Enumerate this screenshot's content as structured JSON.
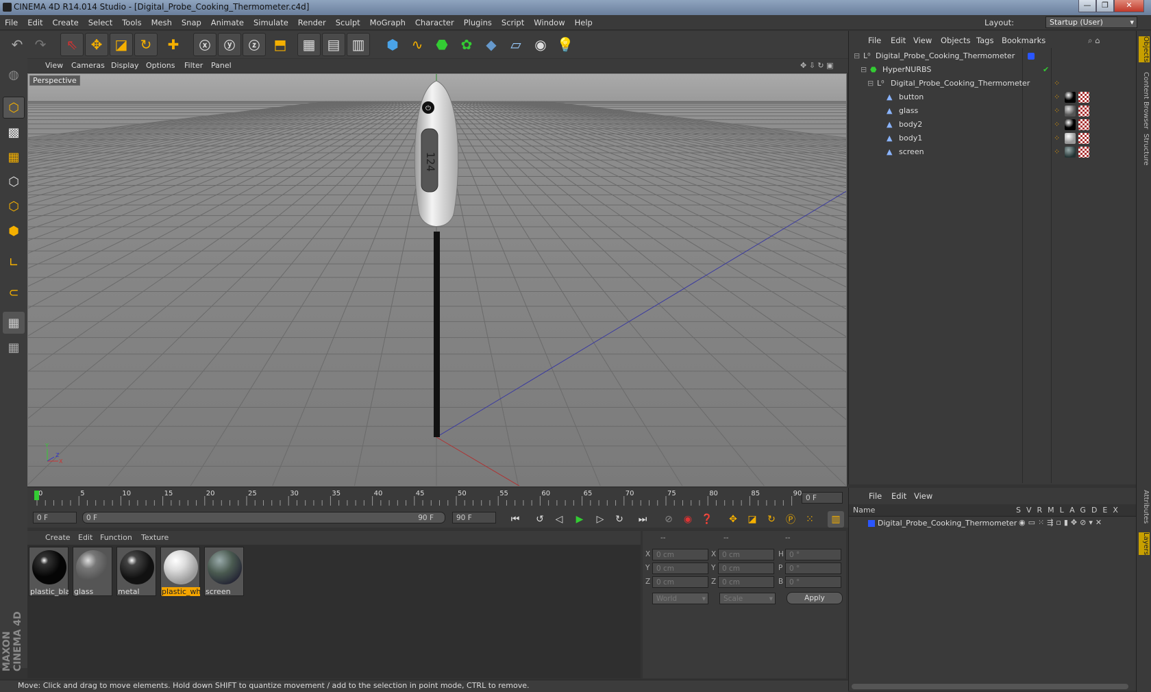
{
  "window": {
    "title": "CINEMA 4D R14.014 Studio - [Digital_Probe_Cooking_Thermometer.c4d]",
    "min": "—",
    "max": "❐",
    "close": "✕"
  },
  "menu": [
    "File",
    "Edit",
    "Create",
    "Select",
    "Tools",
    "Mesh",
    "Snap",
    "Animate",
    "Simulate",
    "Render",
    "Sculpt",
    "MoGraph",
    "Character",
    "Plugins",
    "Script",
    "Window",
    "Help"
  ],
  "layout": {
    "label": "Layout:",
    "value": "Startup (User)"
  },
  "toolbar_icons": [
    "undo-icon",
    "redo-icon",
    "live-selection-icon",
    "move-icon",
    "scale-icon",
    "rotate-icon",
    "add-icon",
    "x-axis-icon",
    "y-axis-icon",
    "z-axis-icon",
    "coordinate-system-icon",
    "render-view-icon",
    "render-picture-viewer-icon",
    "render-settings-icon",
    "cube-icon",
    "spline-pen-icon",
    "nurbs-icon",
    "array-icon",
    "deformer-icon",
    "floor-icon",
    "camera-icon",
    "light-icon"
  ],
  "viewport": {
    "menu": [
      "View",
      "Cameras",
      "Display",
      "Options",
      "Filter",
      "Panel"
    ],
    "label": "Perspective"
  },
  "timeline": {
    "ticks": [
      "0",
      "5",
      "10",
      "15",
      "20",
      "25",
      "30",
      "35",
      "40",
      "45",
      "50",
      "55",
      "60",
      "65",
      "70",
      "75",
      "80",
      "85",
      "90"
    ],
    "current": "0 F",
    "start": "0 F",
    "range_start": "0 F",
    "range_end": "90 F",
    "end": "90 F"
  },
  "materials": {
    "menu": [
      "Create",
      "Edit",
      "Function",
      "Texture"
    ],
    "items": [
      {
        "name": "plastic_bla",
        "color": "#050505"
      },
      {
        "name": "glass",
        "color": "#6a6a6a"
      },
      {
        "name": "metal",
        "color": "#111"
      },
      {
        "name": "plastic_whi",
        "color": "#cfcfcf",
        "selected": true
      },
      {
        "name": "screen",
        "color": "#4a5a50"
      }
    ]
  },
  "coords": {
    "headers": [
      "--",
      "--",
      "--"
    ],
    "rows": [
      {
        "a": "X",
        "av": "0 cm",
        "b": "X",
        "bv": "0 cm",
        "c": "H",
        "cv": "0 °"
      },
      {
        "a": "Y",
        "av": "0 cm",
        "b": "Y",
        "bv": "0 cm",
        "c": "P",
        "cv": "0 °"
      },
      {
        "a": "Z",
        "av": "0 cm",
        "b": "Z",
        "bv": "0 cm",
        "c": "B",
        "cv": "0 °"
      }
    ],
    "world": "World",
    "scale": "Scale",
    "apply": "Apply"
  },
  "objects": {
    "menu": [
      "File",
      "Edit",
      "View",
      "Objects",
      "Tags",
      "Bookmarks"
    ],
    "tree": [
      {
        "name": "Digital_Probe_Cooking_Thermometer",
        "indent": 0
      },
      {
        "name": "HyperNURBS",
        "indent": 1
      },
      {
        "name": "Digital_Probe_Cooking_Thermometer",
        "indent": 2
      },
      {
        "name": "button",
        "indent": 3
      },
      {
        "name": "glass",
        "indent": 3
      },
      {
        "name": "body2",
        "indent": 3
      },
      {
        "name": "body1",
        "indent": 3
      },
      {
        "name": "screen",
        "indent": 3
      }
    ]
  },
  "layers": {
    "menu": [
      "File",
      "Edit",
      "View"
    ],
    "name_header": "Name",
    "cols": [
      "S",
      "V",
      "R",
      "M",
      "L",
      "A",
      "G",
      "D",
      "E",
      "X"
    ],
    "row": "Digital_Probe_Cooking_Thermometer"
  },
  "right_tabs": [
    "Objects",
    "Content Browser",
    "Structure",
    "Attributes",
    "Layers"
  ],
  "status": "Move: Click and drag to move elements. Hold down SHIFT to quantize movement / add to the selection in point mode, CTRL to remove.",
  "brand": "MAXON CINEMA 4D"
}
